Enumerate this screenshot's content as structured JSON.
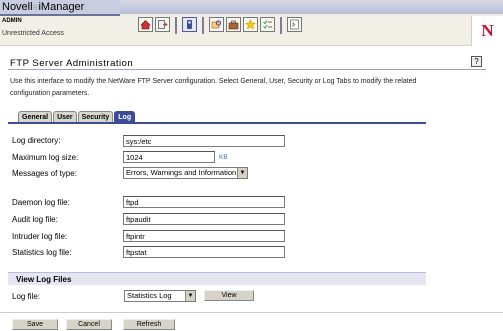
{
  "header": {
    "brand_name": "Novell",
    "brand_product": "iManager",
    "brand_mark": "®",
    "user": "ADMIN",
    "access": "Unrestricted Access",
    "logo_letter": "N",
    "toolbar_icons": [
      "home-icon",
      "exit-icon",
      "roles-tasks-icon",
      "view-objects-icon",
      "configure-icon",
      "favorites-icon",
      "preferences-icon",
      "help-icon"
    ]
  },
  "page": {
    "title": "FTP Server Administration",
    "help_label": "?",
    "description": "Use this interface to modify the NetWare FTP Server configuration. Select General, User, Security or Log Tabs to modify the related configuration parameters."
  },
  "tabs": [
    {
      "label": "General",
      "active": false
    },
    {
      "label": "User",
      "active": false
    },
    {
      "label": "Security",
      "active": false
    },
    {
      "label": "Log",
      "active": true
    }
  ],
  "form": {
    "log_directory": {
      "label": "Log directory:",
      "value": "sys:/etc"
    },
    "max_log_size": {
      "label": "Maximum log size:",
      "value": "1024",
      "unit": "KB"
    },
    "messages_of_type": {
      "label": "Messages of type:",
      "value": "Errors, Warnings and Information"
    },
    "daemon_log": {
      "label": "Daemon log file:",
      "value": "ftpd"
    },
    "audit_log": {
      "label": "Audit log file:",
      "value": "ftpaudit"
    },
    "intruder_log": {
      "label": "Intruder log file:",
      "value": "ftpintr"
    },
    "statistics_log": {
      "label": "Statistics log file:",
      "value": "ftpstat"
    }
  },
  "view_logs": {
    "section_title": "View Log Files",
    "log_file_label": "Log file:",
    "log_file_value": "Statistics Log",
    "view_button": "View"
  },
  "footer": {
    "save": "Save",
    "cancel": "Cancel",
    "refresh": "Refresh"
  }
}
